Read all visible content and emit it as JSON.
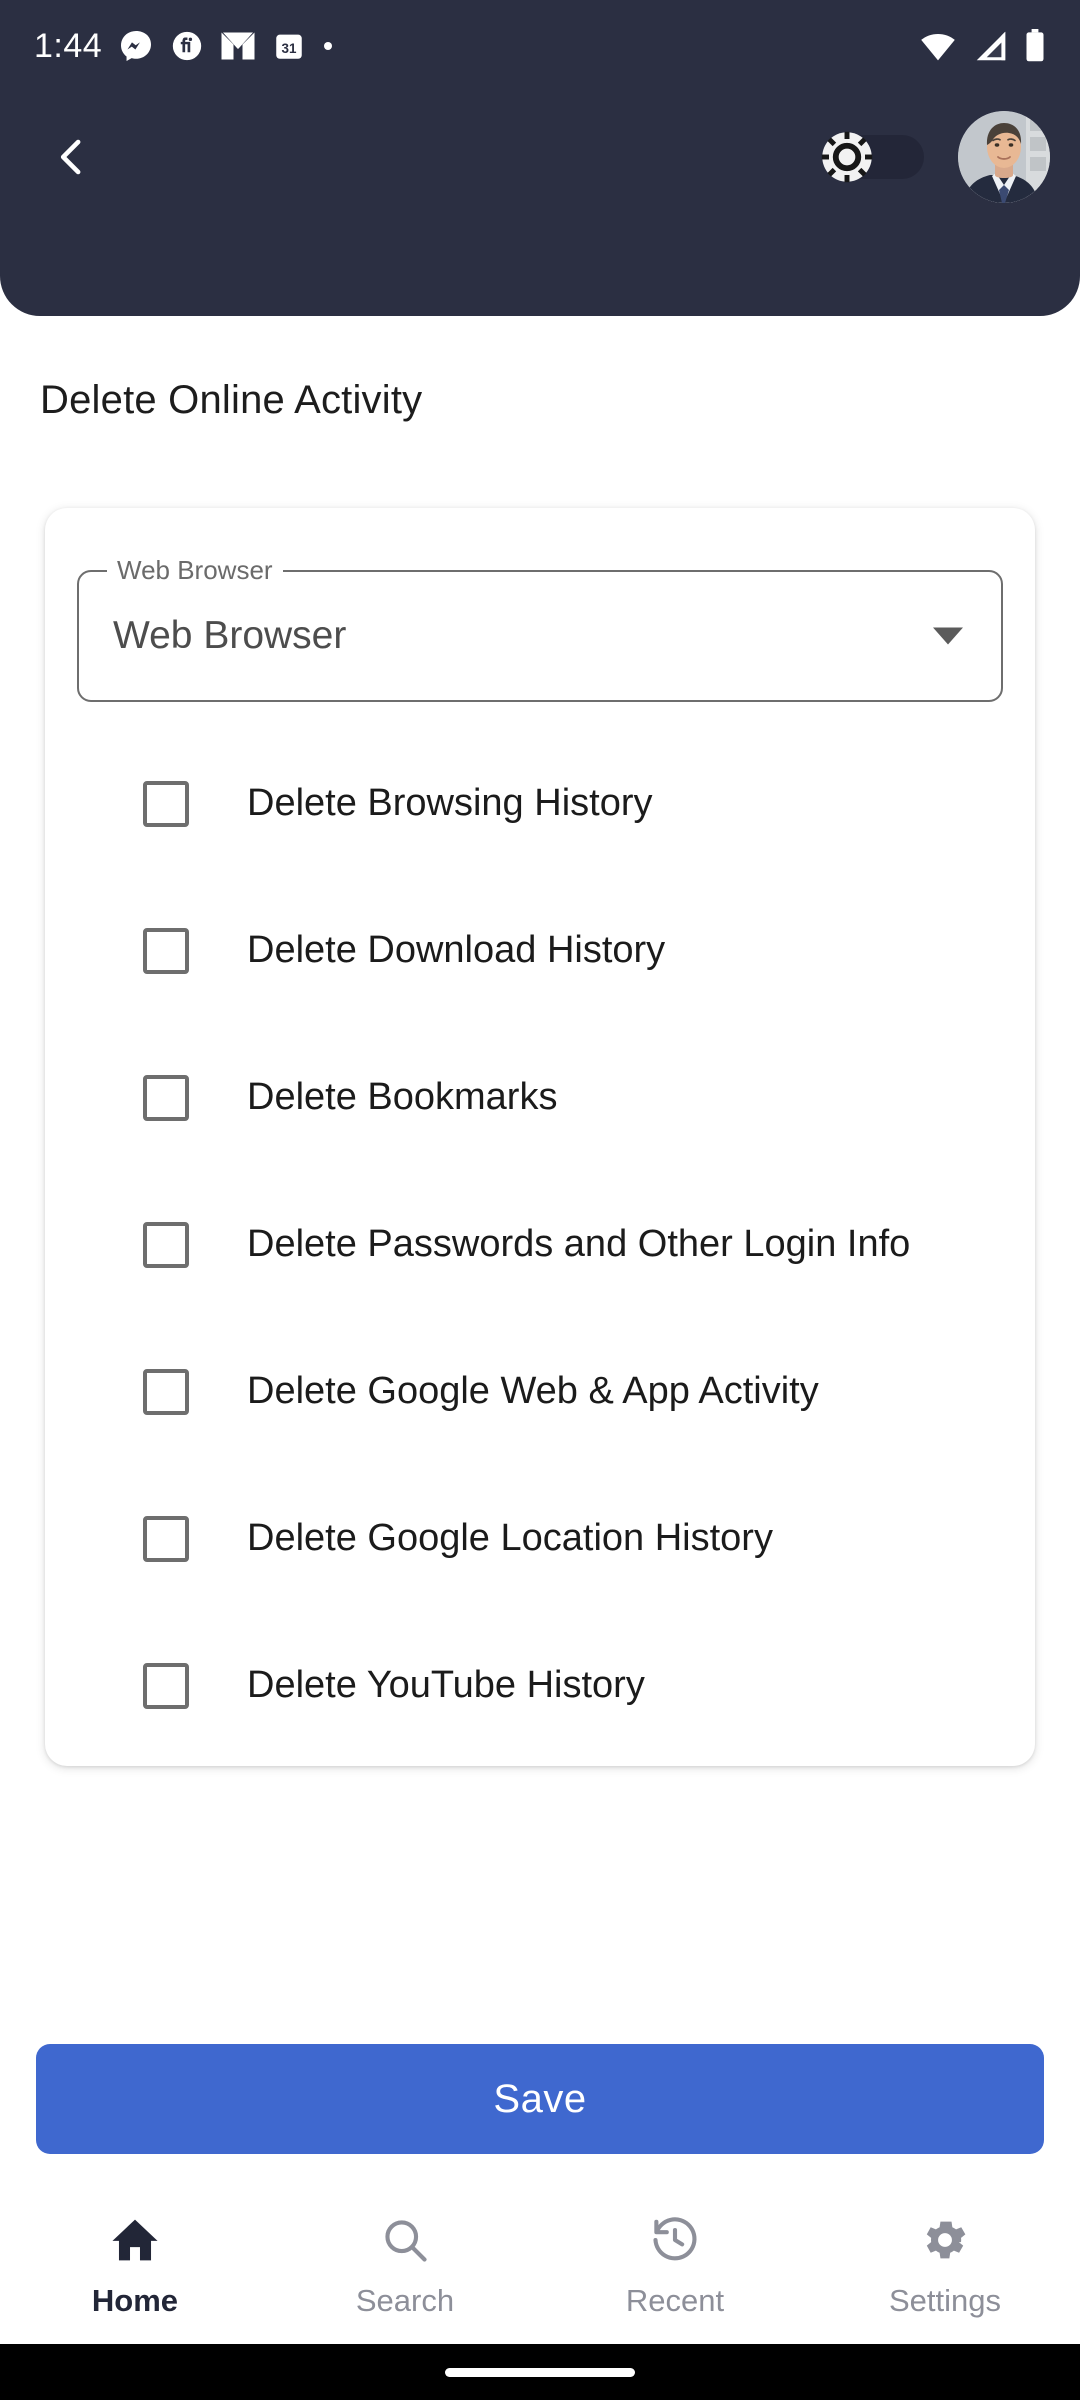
{
  "status_bar": {
    "time": "1:44",
    "left_icons": [
      {
        "name": "messenger-icon"
      },
      {
        "name": "fiverr-icon"
      },
      {
        "name": "gmail-icon"
      },
      {
        "name": "calendar-icon",
        "label": "31"
      },
      {
        "name": "notification-dot-icon"
      }
    ],
    "right_icons": [
      {
        "name": "wifi-icon"
      },
      {
        "name": "cellular-signal-icon"
      },
      {
        "name": "battery-icon"
      }
    ]
  },
  "app_bar": {
    "back_label": "Back",
    "theme_toggle": {
      "name": "theme-toggle",
      "state": "off",
      "icon": "brightness-sun-icon"
    },
    "avatar": {
      "name": "profile-avatar",
      "alt": "User profile photo"
    }
  },
  "page": {
    "title": "Delete Online Activity"
  },
  "select": {
    "label": "Web Browser",
    "value": "Web Browser",
    "placeholder": "Web Browser",
    "arrow_icon": "chevron-down-icon"
  },
  "checkboxes": [
    {
      "label": "Delete Browsing History",
      "checked": false
    },
    {
      "label": "Delete Download History",
      "checked": false
    },
    {
      "label": "Delete Bookmarks",
      "checked": false
    },
    {
      "label": "Delete Passwords and Other Login Info",
      "checked": false
    },
    {
      "label": "Delete Google Web & App Activity",
      "checked": false
    },
    {
      "label": "Delete Google Location History",
      "checked": false
    },
    {
      "label": "Delete YouTube History",
      "checked": false
    }
  ],
  "save_button": {
    "label": "Save"
  },
  "bottom_nav": {
    "items": [
      {
        "label": "Home",
        "icon": "home-icon",
        "active": true
      },
      {
        "label": "Search",
        "icon": "search-icon",
        "active": false
      },
      {
        "label": "Recent",
        "icon": "history-clock-icon",
        "active": false
      },
      {
        "label": "Settings",
        "icon": "gear-icon",
        "active": false
      }
    ]
  },
  "colors": {
    "header_bg": "#2b2f42",
    "accent_blue": "#3f68cf",
    "nav_active": "#222637",
    "nav_inactive": "#8d8f99",
    "outline_gray": "#6e6e6e"
  }
}
